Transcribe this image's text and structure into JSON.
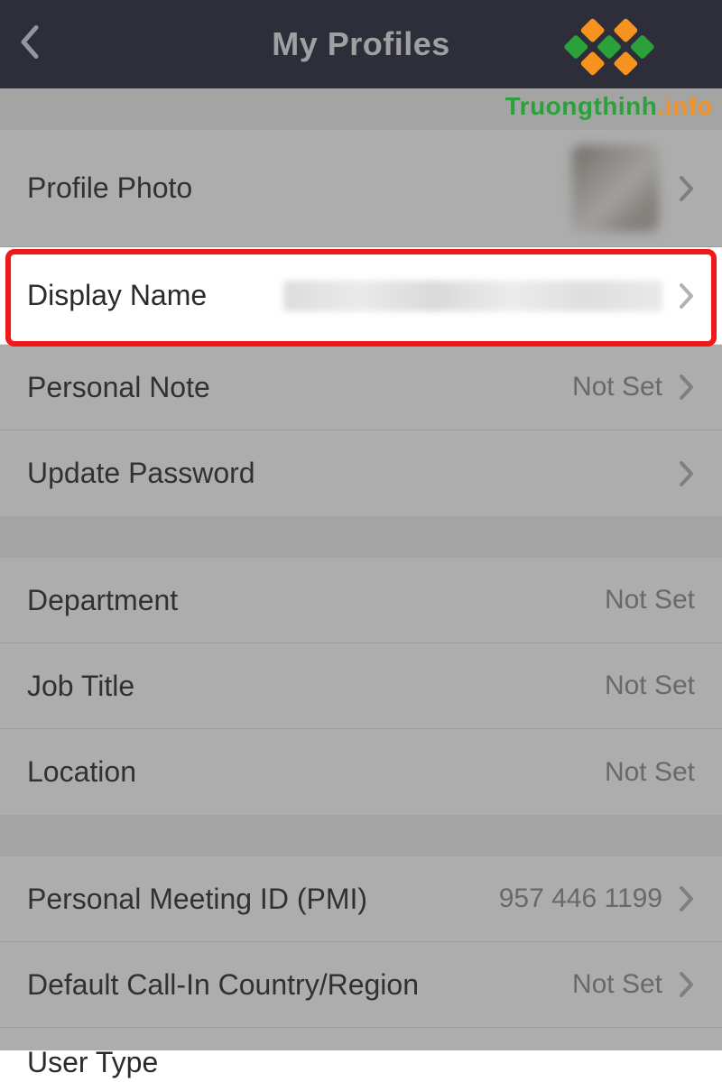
{
  "header": {
    "title": "My Profiles"
  },
  "sections": [
    {
      "rows": [
        {
          "label": "Profile Photo",
          "value": "",
          "has_chevron": true,
          "has_avatar": true
        },
        {
          "label": "Display Name",
          "value": "",
          "has_chevron": true,
          "highlighted": true,
          "has_blur_value": true
        },
        {
          "label": "Personal Note",
          "value": "Not Set",
          "has_chevron": true
        },
        {
          "label": "Update Password",
          "value": "",
          "has_chevron": true
        }
      ]
    },
    {
      "rows": [
        {
          "label": "Department",
          "value": "Not Set",
          "has_chevron": false
        },
        {
          "label": "Job Title",
          "value": "Not Set",
          "has_chevron": false
        },
        {
          "label": "Location",
          "value": "Not Set",
          "has_chevron": false
        }
      ]
    },
    {
      "rows": [
        {
          "label": "Personal Meeting ID (PMI)",
          "value": "957 446 1199",
          "has_chevron": true
        },
        {
          "label": "Default Call-In Country/Region",
          "value": "Not Set",
          "has_chevron": true
        },
        {
          "label": "User Type",
          "value": "",
          "has_chevron": false,
          "partial": true
        }
      ]
    }
  ],
  "watermark": {
    "part1": "Truongthinh",
    "part2": ".info"
  }
}
